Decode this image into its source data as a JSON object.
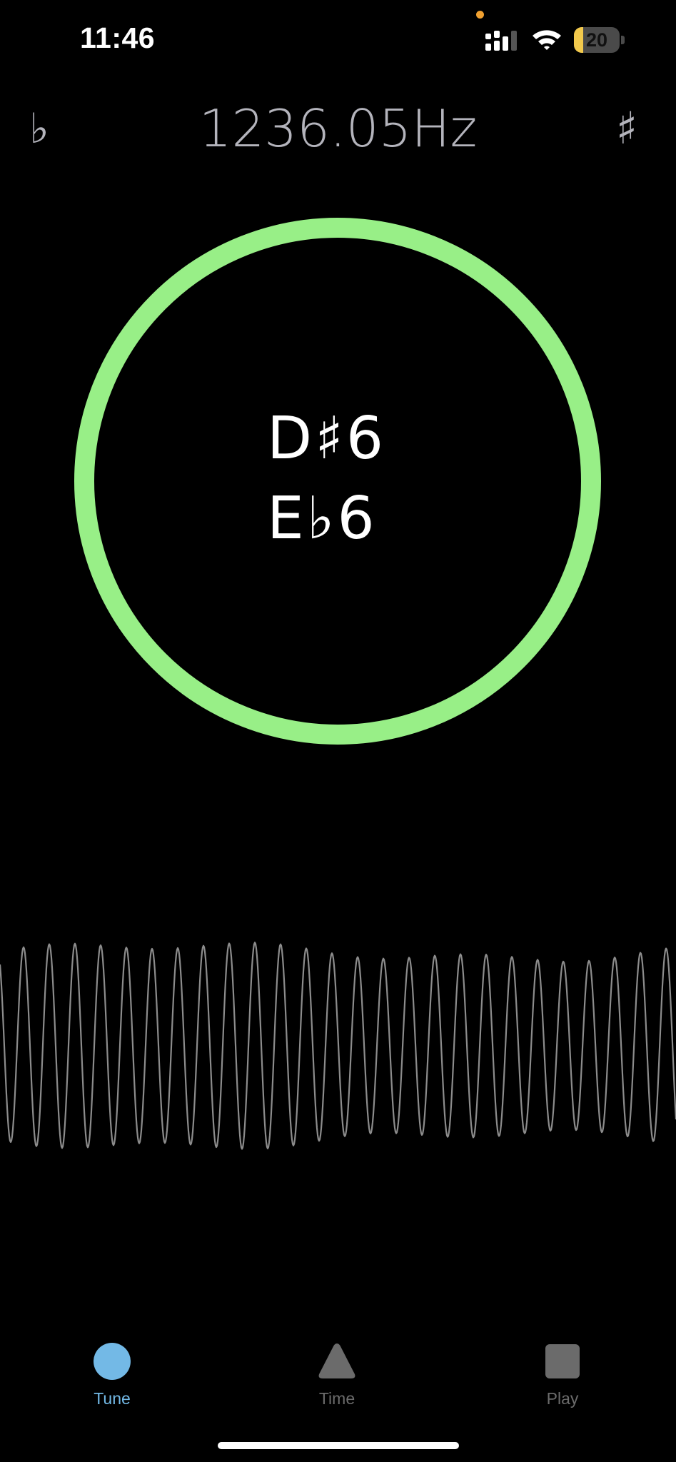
{
  "status_bar": {
    "time": "11:46",
    "battery_level": "20",
    "battery_fraction": 0.2,
    "icons": [
      "signal-icon",
      "wifi-icon",
      "battery-icon"
    ],
    "privacy_indicator_color": "#f0a030"
  },
  "header": {
    "flat_symbol": "♭",
    "frequency": "1236.05Hz",
    "sharp_symbol": "♯"
  },
  "tuner": {
    "note_sharp": "D♯6",
    "note_flat": "E♭6",
    "ring_color": "#98ef87"
  },
  "waveform": {
    "color": "#8c8c8c"
  },
  "tab_bar": {
    "tabs": [
      {
        "label": "Tune",
        "icon": "circle-icon",
        "active": true,
        "color": "#73b9e6"
      },
      {
        "label": "Time",
        "icon": "triangle-icon",
        "active": false,
        "color": "#6b6b6b"
      },
      {
        "label": "Play",
        "icon": "square-icon",
        "active": false,
        "color": "#6b6b6b"
      }
    ]
  }
}
